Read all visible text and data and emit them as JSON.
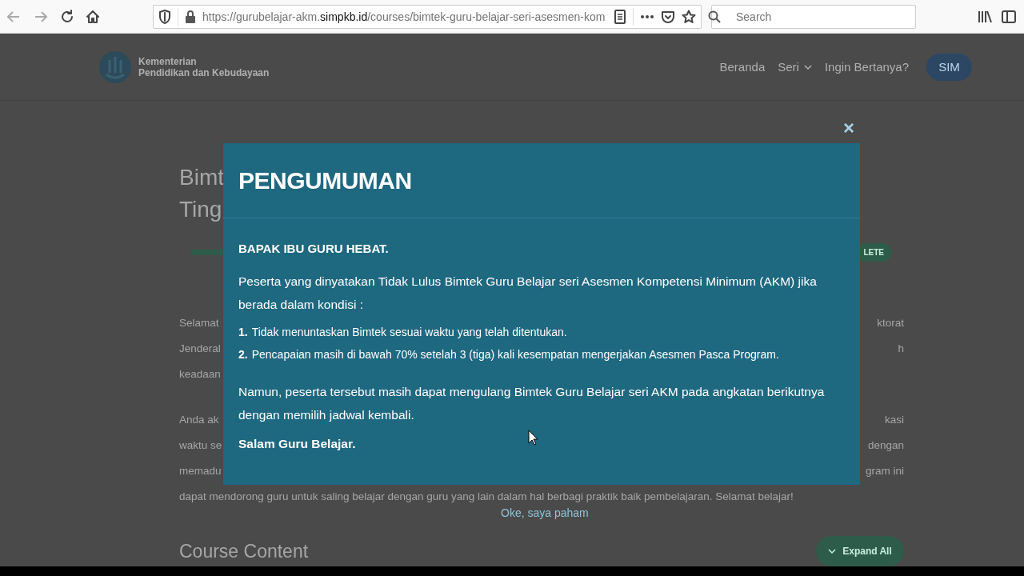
{
  "browser": {
    "url": {
      "start": "https://gurubelajar-akm.",
      "domain": "simpkb.id",
      "rest": "/courses/bimtek-guru-belajar-seri-asesmen-kom"
    },
    "search": {
      "placeholder": "Search"
    }
  },
  "site_header": {
    "logo_lines": [
      "Kementerian",
      "Pendidikan dan Kebudayaan"
    ],
    "nav": [
      {
        "label": "Beranda",
        "kind": "link"
      },
      {
        "label": "Seri",
        "kind": "dropdown"
      },
      {
        "label": "Ingin Bertanya?",
        "kind": "link"
      },
      {
        "label": "SIM",
        "kind": "button"
      }
    ]
  },
  "course": {
    "title_lines": [
      "Bimt",
      "Ting"
    ],
    "progress": {
      "level": 1
    },
    "badge": "LETE",
    "paragraphs": [
      {
        "lines": [
          {
            "left": "Selamat",
            "right": "ktorat"
          },
          {
            "left": "Jenderal",
            "right": "h"
          },
          {
            "left": "keadaan"
          }
        ]
      },
      {
        "lines": [
          {
            "left": "Anda ak",
            "right": "kasi"
          },
          {
            "left": "waktu se",
            "right": "dengan"
          },
          {
            "left": "memadu",
            "right": "gram ini"
          },
          {
            "full": "dapat mendorong guru untuk saling belajar dengan guru yang lain dalam hal berbagi praktik baik pembelajaran. Selamat belajar!"
          }
        ]
      }
    ],
    "section_title": "Course Content",
    "expand_button": "Expand All"
  },
  "modal": {
    "close": "×",
    "title": "PENGUMUMAN",
    "greeting": "BAPAK IBU GURU HEBAT.",
    "intro": "Peserta yang dinyatakan Tidak Lulus Bimtek Guru Belajar seri Asesmen Kompetensi Minimum (AKM) jika berada dalam kondisi :",
    "conditions": [
      {
        "number": "1.",
        "text": "Tidak menuntaskan Bimtek sesuai waktu yang telah ditentukan."
      },
      {
        "number": "2.",
        "text": "Pencapaian masih di bawah 70% setelah 3 (tiga) kali kesempatan mengerjakan Asesmen Pasca Program."
      }
    ],
    "note": "Namun, peserta tersebut masih dapat mengulang Bimtek Guru Belajar seri AKM pada angkatan berikutnya dengan memilih jadwal kembali.",
    "signoff": "Salam Guru Belajar.",
    "confirm": "Oke, saya paham"
  }
}
